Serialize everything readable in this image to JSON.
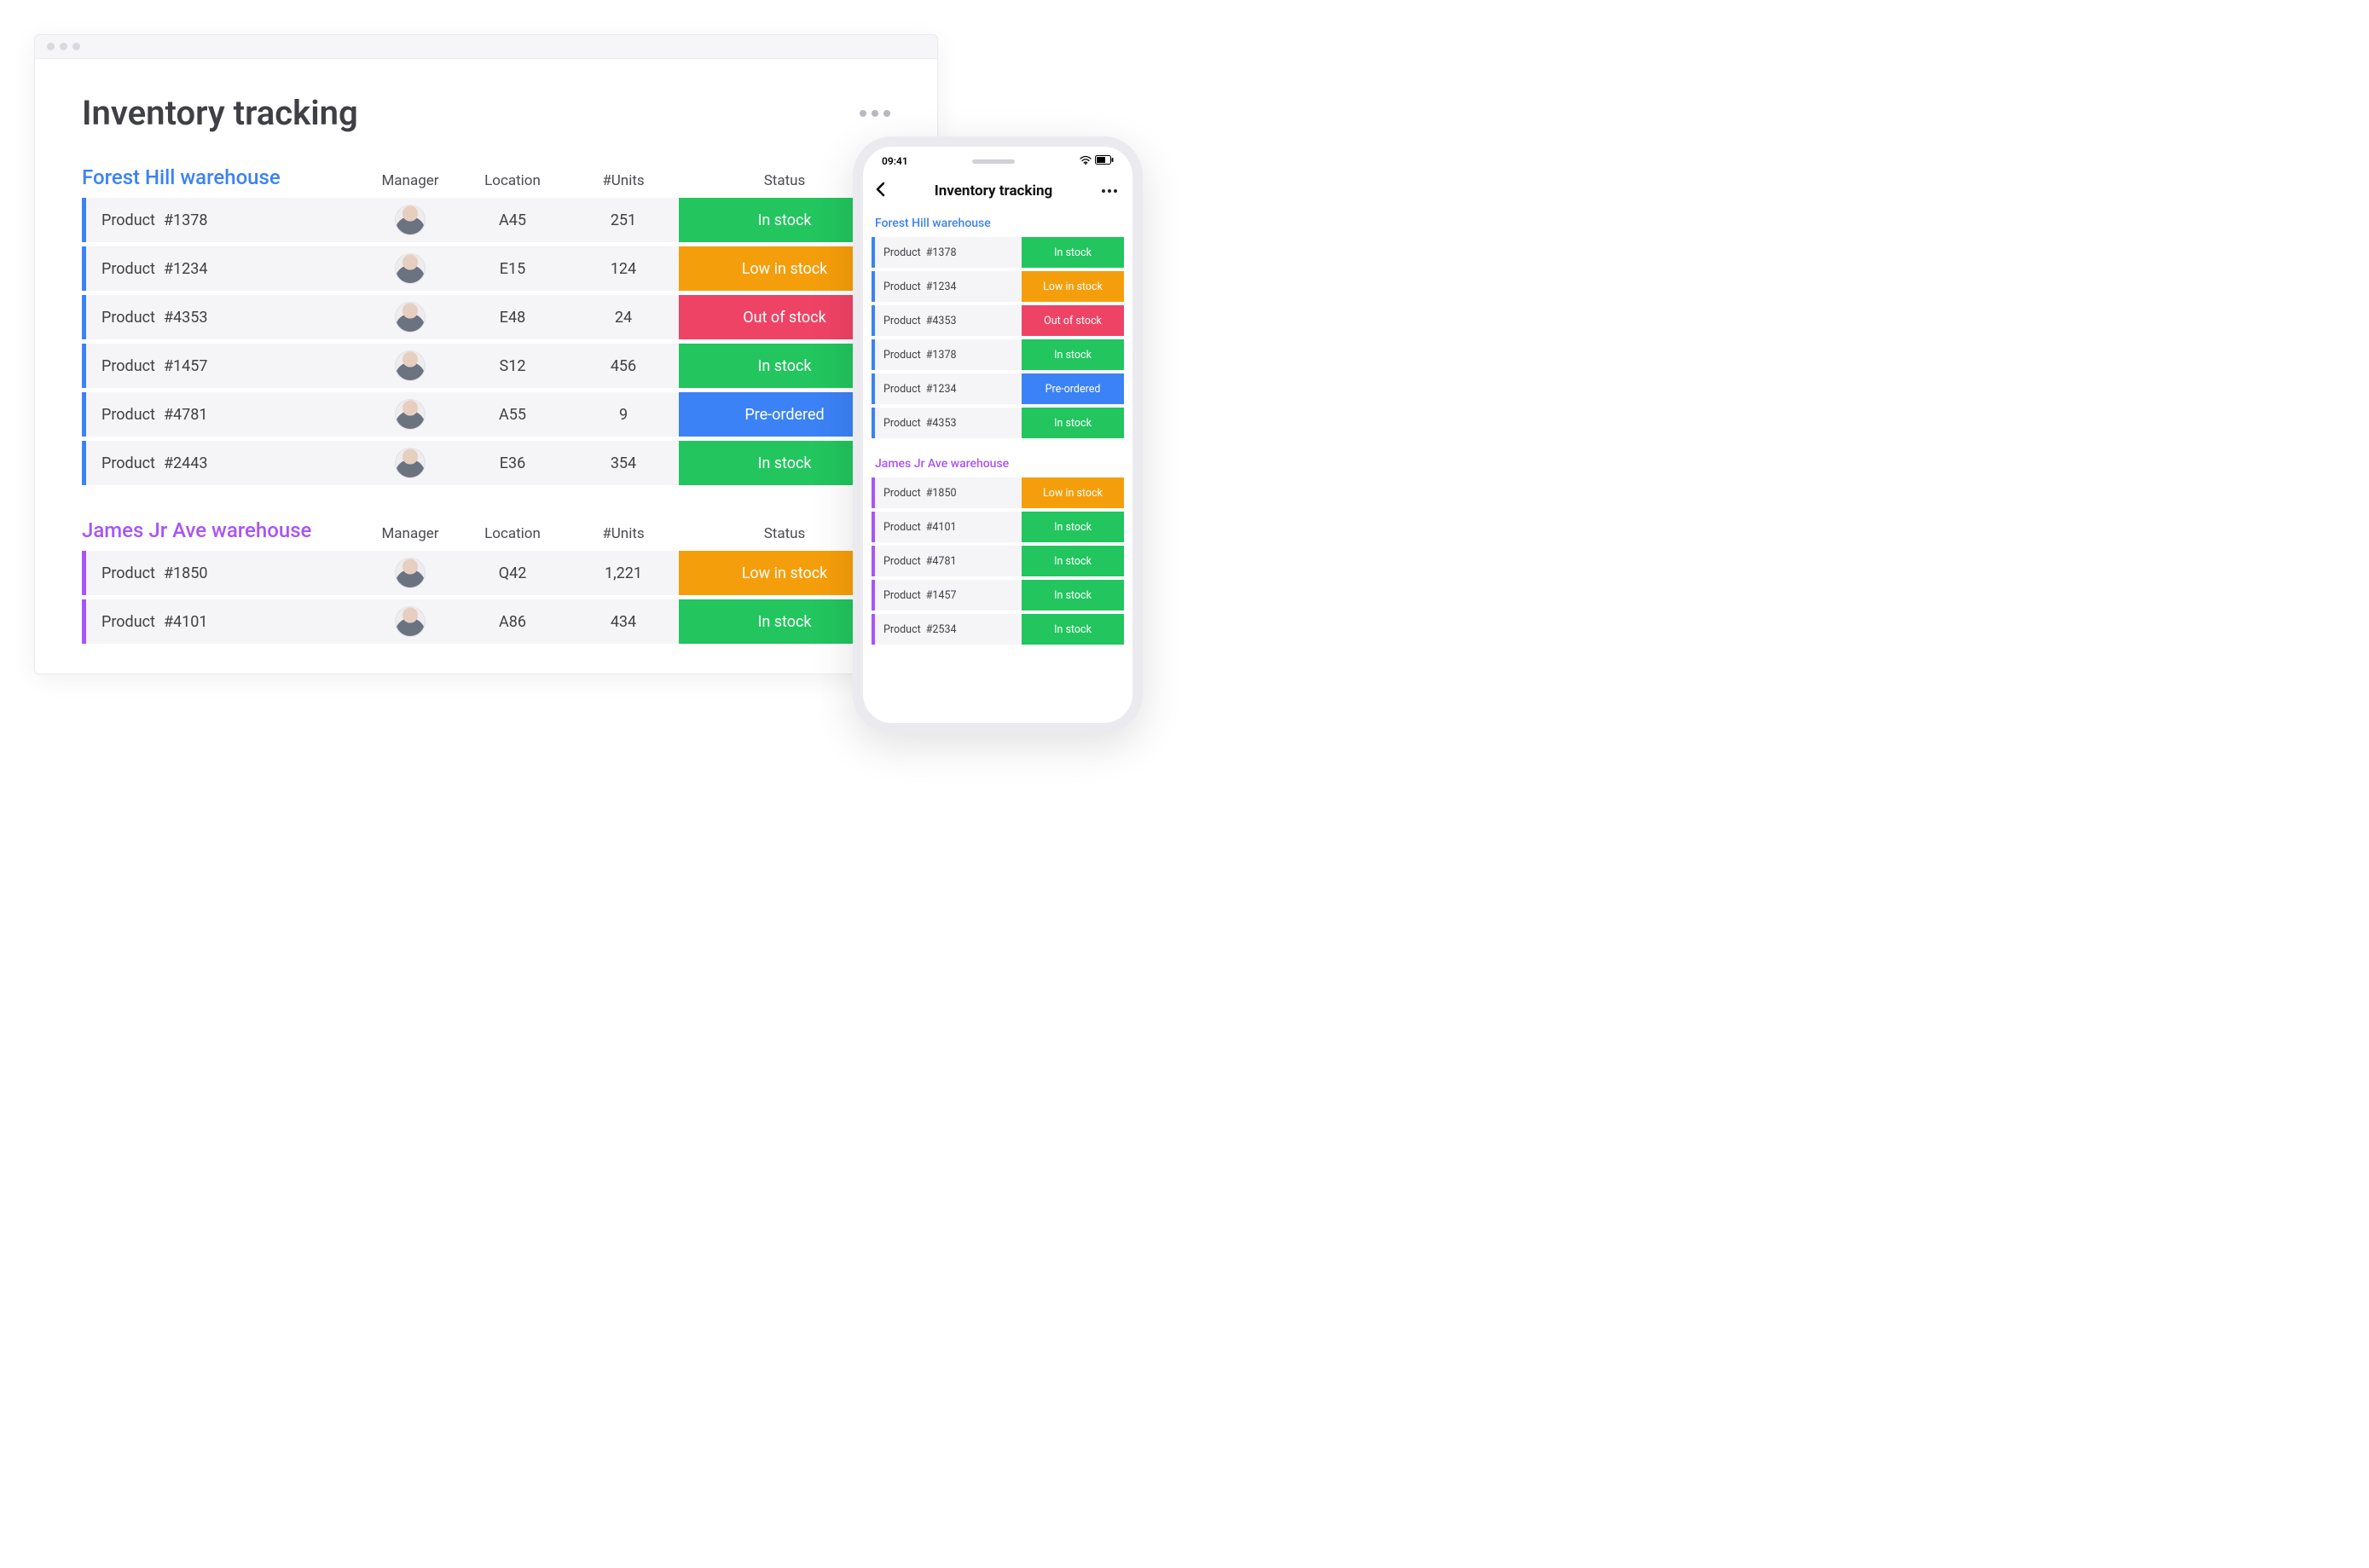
{
  "desktop": {
    "page_title": "Inventory tracking",
    "columns": {
      "manager": "Manager",
      "location": "Location",
      "units": "#Units",
      "status": "Status"
    },
    "sections": [
      {
        "title": "Forest Hill warehouse",
        "color": "blue",
        "rows": [
          {
            "name_prefix": "Product",
            "id": "#1378",
            "location": "A45",
            "units": "251",
            "status": "In stock",
            "status_class": "status-in-stock"
          },
          {
            "name_prefix": "Product",
            "id": "#1234",
            "location": "E15",
            "units": "124",
            "status": "Low in stock",
            "status_class": "status-low"
          },
          {
            "name_prefix": "Product",
            "id": "#4353",
            "location": "E48",
            "units": "24",
            "status": "Out of stock",
            "status_class": "status-out"
          },
          {
            "name_prefix": "Product",
            "id": "#1457",
            "location": "S12",
            "units": "456",
            "status": "In stock",
            "status_class": "status-in-stock"
          },
          {
            "name_prefix": "Product",
            "id": "#4781",
            "location": "A55",
            "units": "9",
            "status": "Pre-ordered",
            "status_class": "status-pre"
          },
          {
            "name_prefix": "Product",
            "id": "#2443",
            "location": "E36",
            "units": "354",
            "status": "In stock",
            "status_class": "status-in-stock"
          }
        ]
      },
      {
        "title": "James Jr Ave warehouse",
        "color": "purple",
        "rows": [
          {
            "name_prefix": "Product",
            "id": "#1850",
            "location": "Q42",
            "units": "1,221",
            "status": "Low in stock",
            "status_class": "status-low"
          },
          {
            "name_prefix": "Product",
            "id": "#4101",
            "location": "A86",
            "units": "434",
            "status": "In stock",
            "status_class": "status-in-stock"
          }
        ]
      }
    ]
  },
  "phone": {
    "time": "09:41",
    "title": "Inventory tracking",
    "sections": [
      {
        "title": "Forest Hill warehouse",
        "color": "blue",
        "rows": [
          {
            "name_prefix": "Product",
            "id": "#1378",
            "status": "In stock",
            "status_class": "status-in-stock"
          },
          {
            "name_prefix": "Product",
            "id": "#1234",
            "status": "Low in stock",
            "status_class": "status-low"
          },
          {
            "name_prefix": "Product",
            "id": "#4353",
            "status": "Out of stock",
            "status_class": "status-out"
          },
          {
            "name_prefix": "Product",
            "id": "#1378",
            "status": "In stock",
            "status_class": "status-in-stock"
          },
          {
            "name_prefix": "Product",
            "id": "#1234",
            "status": "Pre-ordered",
            "status_class": "status-pre"
          },
          {
            "name_prefix": "Product",
            "id": "#4353",
            "status": "In stock",
            "status_class": "status-in-stock"
          }
        ]
      },
      {
        "title": "James Jr Ave warehouse",
        "color": "purple",
        "rows": [
          {
            "name_prefix": "Product",
            "id": "#1850",
            "status": "Low in stock",
            "status_class": "status-low"
          },
          {
            "name_prefix": "Product",
            "id": "#4101",
            "status": "In stock",
            "status_class": "status-in-stock"
          },
          {
            "name_prefix": "Product",
            "id": "#4781",
            "status": "In stock",
            "status_class": "status-in-stock"
          },
          {
            "name_prefix": "Product",
            "id": "#1457",
            "status": "In stock",
            "status_class": "status-in-stock"
          },
          {
            "name_prefix": "Product",
            "id": "#2534",
            "status": "In stock",
            "status_class": "status-in-stock"
          }
        ]
      }
    ]
  }
}
